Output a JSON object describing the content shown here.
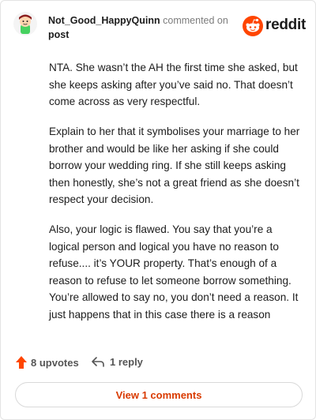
{
  "header": {
    "username": "Not_Good_HappyQuinn",
    "action_text": "commented on",
    "target_link": "post",
    "logo_text": "reddit",
    "logo_color": "#ff4500"
  },
  "comment": {
    "paragraphs": [
      "NTA. She wasn’t the AH the first time she asked, but she keeps asking after you’ve said no. That doesn’t come across as very respectful.",
      "Explain to her that it symbolises your marriage to her brother and would be like her asking if she could borrow your wedding ring. If she still keeps asking then honestly, she’s not a great friend as she doesn’t respect your decision.",
      "Also, your logic is flawed. You say that you’re a logical person and logical you have no reason to refuse.... it’s YOUR property. That’s enough of a reason to refuse to let someone borrow something. You’re allowed to say no, you don’t need a reason. It just happens that in this case there is a reason"
    ]
  },
  "footer": {
    "upvotes_label": "8 upvotes",
    "upvote_color": "#ff4500",
    "reply_label": "1 reply",
    "view_comments_label": "View 1 comments",
    "view_comments_color": "#d93a00"
  }
}
